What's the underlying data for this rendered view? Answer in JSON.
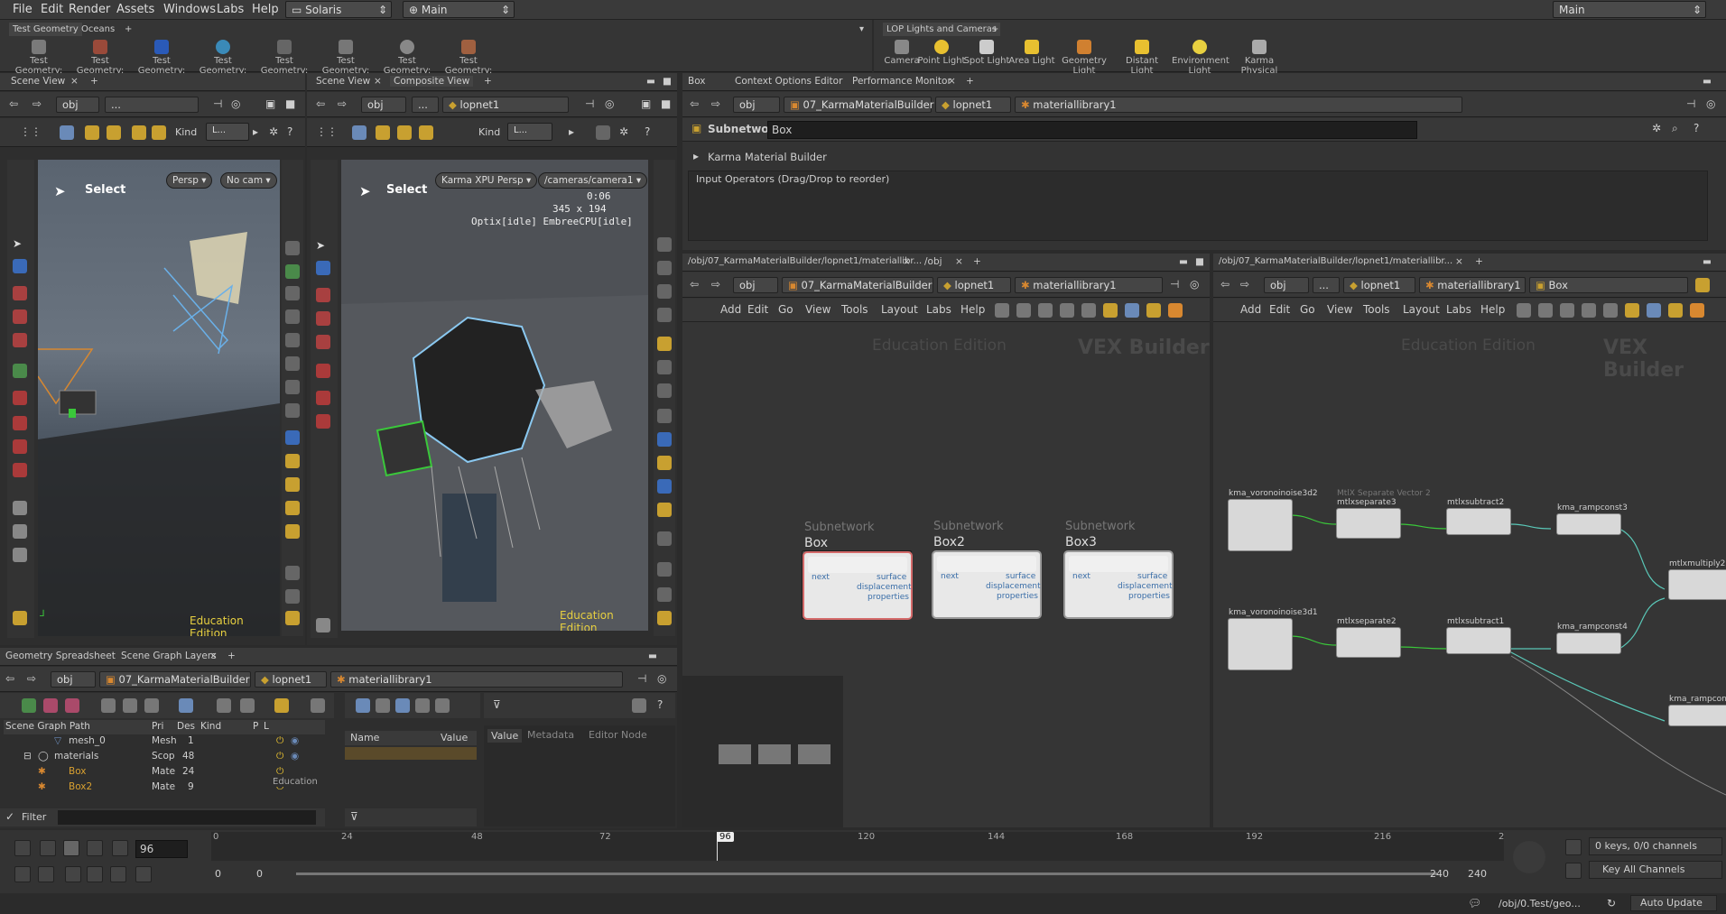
{
  "menubar": {
    "items": [
      "File",
      "Edit",
      "Render",
      "Assets",
      "Windows",
      "Labs",
      "Help"
    ],
    "desktop": "Solaris",
    "layout": "Main",
    "right_desktop": "Main"
  },
  "shelf_left": {
    "tabs": [
      "Test Geometry",
      "Oceans"
    ],
    "tools": [
      "Test Geometry: C...",
      "Test Geometry: P...",
      "Test Geometry: R...",
      "Test Geometry: S...",
      "Test Geometry: S...",
      "Test Geometry: T...",
      "Test Geometry: T...",
      "Test Geometry: T..."
    ]
  },
  "shelf_right": {
    "tabs": [
      "LOP Lights and Cameras"
    ],
    "tools": [
      "Camera",
      "Point Light",
      "Spot Light",
      "Area Light",
      "Geometry Light",
      "Distant Light",
      "Environment Light",
      "Karma Physical Sky..."
    ]
  },
  "scene_view_left": {
    "tab": "Scene View",
    "path_obj": "obj",
    "path_more": "...",
    "kind_label": "Kind",
    "kind_value": "L...",
    "select_label": "Select",
    "persp": "Persp",
    "cam": "No cam",
    "edition": "Education Edition"
  },
  "scene_view_mid": {
    "tabs": [
      "Scene View",
      "Composite View"
    ],
    "path_obj": "obj",
    "path_more": "...",
    "path_node": "lopnet1",
    "kind_label": "Kind",
    "kind_value": "L...",
    "select_label": "Select",
    "persp": "Karma XPU Persp",
    "cam": "/cameras/camera1",
    "time": "0:06",
    "res": "345 x 194",
    "status": "Optix[idle] EmbreeCPU[idle]",
    "edition": "Education Edition"
  },
  "params": {
    "tabs": [
      "Box",
      "Context Options Editor",
      "Performance Monitor"
    ],
    "path": [
      "obj",
      "07_KarmaMaterialBuilder",
      "lopnet1",
      "materiallibrary1"
    ],
    "type_label": "Subnetwork",
    "name": "Box",
    "section": "Karma Material Builder",
    "input_ops": "Input Operators (Drag/Drop to reorder)"
  },
  "net_left": {
    "tabs": [
      "/obj/07_KarmaMaterialBuilder/lopnet1/materiallibr...",
      "/obj"
    ],
    "path": [
      "obj",
      "07_KarmaMaterialBuilder",
      "lopnet1",
      "materiallibrary1"
    ],
    "menu": [
      "Add",
      "Edit",
      "Go",
      "View",
      "Tools",
      "Layout",
      "Labs",
      "Help"
    ],
    "watermark_edu": "Education Edition",
    "watermark_ctx": "VEX Builder",
    "nodes": [
      {
        "type": "Subnetwork",
        "name": "Box"
      },
      {
        "type": "Subnetwork",
        "name": "Box2"
      },
      {
        "type": "Subnetwork",
        "name": "Box3"
      }
    ],
    "ports": {
      "input": "next",
      "outputs": [
        "surface",
        "displacement",
        "properties"
      ]
    }
  },
  "net_right": {
    "tabs": [
      "/obj/07_KarmaMaterialBuilder/lopnet1/materiallibr..."
    ],
    "path": [
      "obj",
      "...",
      "lopnet1",
      "materiallibrary1",
      "Box"
    ],
    "menu": [
      "Add",
      "Edit",
      "Go",
      "View",
      "Tools",
      "Layout",
      "Labs",
      "Help"
    ],
    "watermark_edu": "Education Edition",
    "watermark_ctx": "VEX Builder",
    "nodes": [
      "kma_voronoinoise3d2",
      "MtlX Separate Vector 2",
      "mtlxseparate3",
      "mtlxsubtract2",
      "kma_rampconst3",
      "mtlxmultiply2",
      "kma_voronoinoise3d1",
      "mtlxseparate2",
      "mtlxsubtract1",
      "kma_rampconst4",
      "kma_rampcons..."
    ]
  },
  "spreadsheet": {
    "tabs": [
      "Geometry Spreadsheet",
      "Scene Graph Layers"
    ],
    "path": [
      "obj",
      "07_KarmaMaterialBuilder",
      "lopnet1",
      "materiallibrary1"
    ],
    "columns": [
      "Scene Graph Path",
      "Pri",
      "Des",
      "Kind",
      "P",
      "L"
    ],
    "rows": [
      {
        "name": "mesh_0",
        "pri": "Mesh",
        "des": "1"
      },
      {
        "name": "materials",
        "pri": "Scop",
        "des": "48"
      },
      {
        "name": "Box",
        "pri": "Mate",
        "des": "24"
      },
      {
        "name": "Box2",
        "pri": "Mate",
        "des": "9"
      }
    ],
    "prop_cols": [
      "Name",
      "Value"
    ],
    "value_tabs": [
      "Value",
      "Metadata",
      "Editor Node"
    ],
    "filter": "Filter",
    "edu_stamp": "Education"
  },
  "timeline": {
    "frame": "96",
    "marker": "96",
    "ticks": [
      "0",
      "24",
      "48",
      "72",
      "120",
      "144",
      "168",
      "192",
      "216",
      "2"
    ],
    "start": "0",
    "start2": "0",
    "end": "240",
    "end2": "240",
    "keys": "0 keys, 0/0 channels",
    "key_all": "Key All Channels"
  },
  "statusbar": {
    "path": "/obj/0.Test/geo...",
    "auto_update": "Auto Update"
  }
}
